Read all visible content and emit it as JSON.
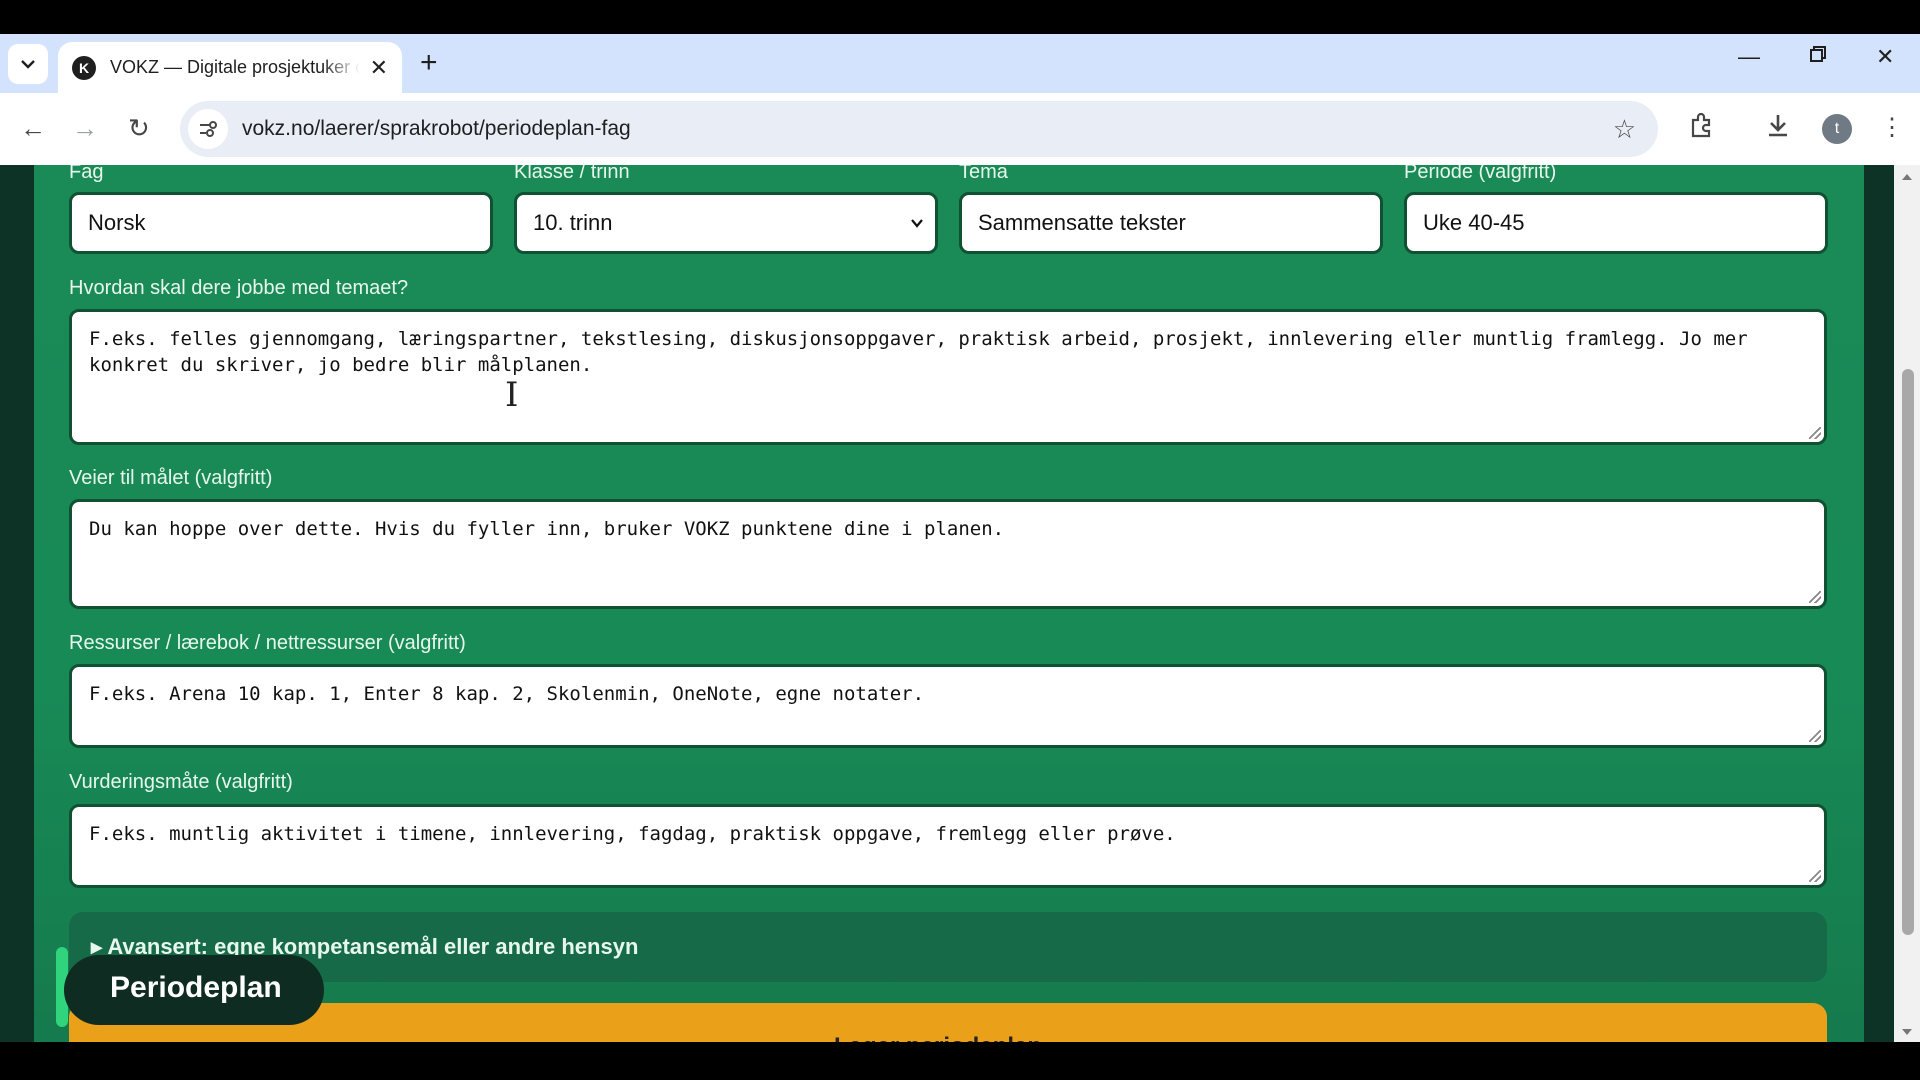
{
  "browser": {
    "tab_title": "VOKZ — Digitale prosjektuker og",
    "favicon_letter": "K",
    "url": "vokz.no/laerer/sprakrobot/periodeplan-fag",
    "profile_initial": "t"
  },
  "form": {
    "fag": {
      "label": "Fag",
      "value": "Norsk"
    },
    "klasse": {
      "label": "Klasse / trinn",
      "value": "10. trinn"
    },
    "tema": {
      "label": "Tema",
      "value": "Sammensatte tekster"
    },
    "periode": {
      "label": "Periode (valgfritt)",
      "value": "Uke 40-45"
    },
    "jobbe": {
      "label": "Hvordan skal dere jobbe med temaet?",
      "placeholder": "F.eks. felles gjennomgang, læringspartner, tekstlesing, diskusjonsoppgaver, praktisk arbeid, prosjekt, innlevering eller muntlig framlegg. Jo mer konkret du skriver, jo bedre blir målplanen."
    },
    "veier": {
      "label": "Veier til målet (valgfritt)",
      "placeholder": "Du kan hoppe over dette. Hvis du fyller inn, bruker VOKZ punktene dine i planen."
    },
    "ressurser": {
      "label": "Ressurser / lærebok / nettressurser (valgfritt)",
      "placeholder": "F.eks. Arena 10 kap. 1, Enter 8 kap. 2, Skolenmin, OneNote, egne notater."
    },
    "vurdering": {
      "label": "Vurderingsmåte (valgfritt)",
      "placeholder": "F.eks. muntlig aktivitet i timene, innlevering, fagdag, praktisk oppgave, fremlegg eller prøve."
    },
    "advanced_label": "▸ Avansert: egne kompetansemål eller andre hensyn",
    "generate_label": "Lager periodeplan..."
  },
  "badge": "Periodeplan"
}
